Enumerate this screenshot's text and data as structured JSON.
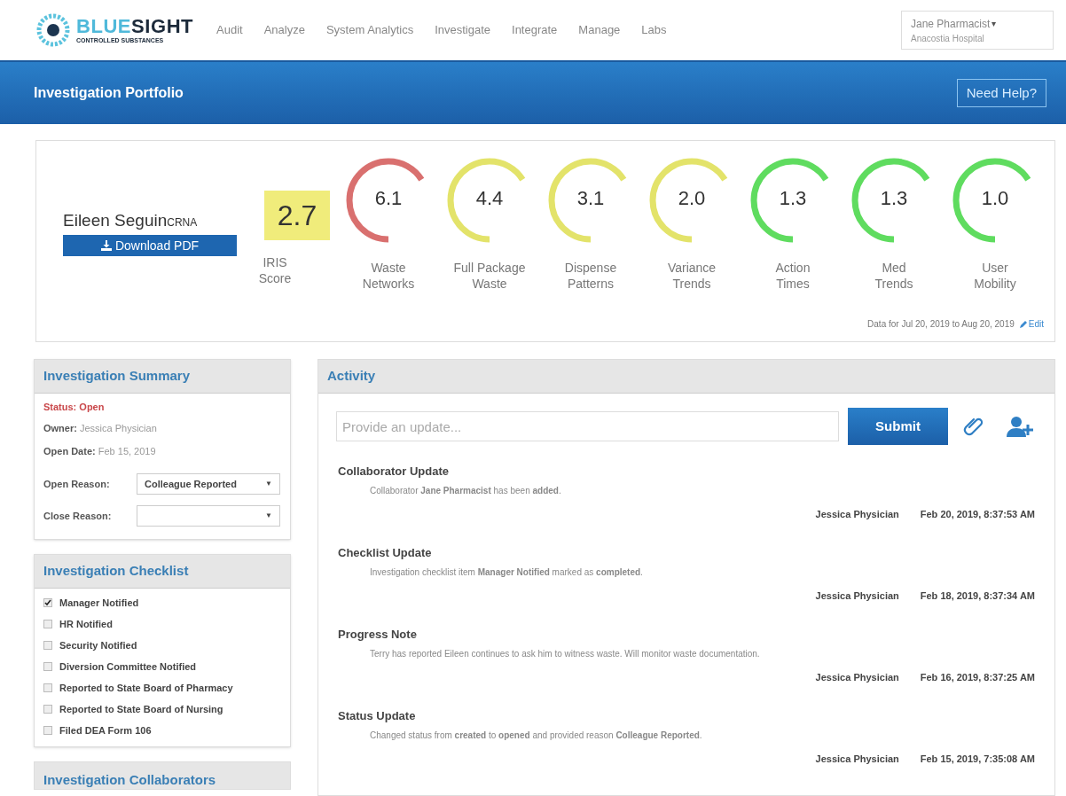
{
  "brand": {
    "name_part_1": "BLUE",
    "name_part_2": "SIGHT",
    "tagline": "CONTROLLED SUBSTANCES"
  },
  "nav": [
    "Audit",
    "Analyze",
    "System Analytics",
    "Investigate",
    "Integrate",
    "Manage",
    "Labs"
  ],
  "user": {
    "name": "Jane Pharmacist",
    "caret": "▾",
    "location": "Anacostia Hospital"
  },
  "page_title": "Investigation Portfolio",
  "help_button": "Need Help?",
  "subject": {
    "name": "Eileen Seguin",
    "credential": "CRNA",
    "download_button": "Download PDF"
  },
  "iris": {
    "score": "2.7",
    "label_line_1": "IRIS",
    "label_line_2": "Score"
  },
  "gauges": [
    {
      "value": "6.1",
      "label_line_1": "Waste",
      "label_line_2": "Networks",
      "color": "#d9706f"
    },
    {
      "value": "4.4",
      "label_line_1": "Full Package",
      "label_line_2": "Waste",
      "color": "#e3e36a"
    },
    {
      "value": "3.1",
      "label_line_1": "Dispense",
      "label_line_2": "Patterns",
      "color": "#e3e36a"
    },
    {
      "value": "2.0",
      "label_line_1": "Variance",
      "label_line_2": "Trends",
      "color": "#e3e36a"
    },
    {
      "value": "1.3",
      "label_line_1": "Action",
      "label_line_2": "Times",
      "color": "#5fdc5f"
    },
    {
      "value": "1.3",
      "label_line_1": "Med",
      "label_line_2": "Trends",
      "color": "#5fdc5f"
    },
    {
      "value": "1.0",
      "label_line_1": "User",
      "label_line_2": "Mobility",
      "color": "#5fdc5f"
    }
  ],
  "date_range": "Data for Jul 20, 2019 to Aug 20, 2019",
  "edit_link": "Edit",
  "summary": {
    "title": "Investigation Summary",
    "status": "Status: Open",
    "owner_label": "Owner:",
    "owner": "Jessica Physician",
    "open_date_label": "Open Date:",
    "open_date": "Feb 15, 2019",
    "open_reason_label": "Open Reason:",
    "open_reason": "Colleague Reported",
    "open_reason_caret": "▼",
    "close_reason_label": "Close Reason:",
    "close_reason_caret": "▼"
  },
  "checklist": {
    "title": "Investigation Checklist",
    "items": [
      {
        "label": "Manager Notified",
        "checked": true
      },
      {
        "label": "HR Notified",
        "checked": false
      },
      {
        "label": "Security Notified",
        "checked": false
      },
      {
        "label": "Diversion Committee Notified",
        "checked": false
      },
      {
        "label": "Reported to State Board of Pharmacy",
        "checked": false
      },
      {
        "label": "Reported to State Board of Nursing",
        "checked": false
      },
      {
        "label": "Filed DEA Form 106",
        "checked": false
      }
    ]
  },
  "collaborators": {
    "title": "Investigation Collaborators"
  },
  "activity": {
    "title": "Activity",
    "placeholder": "Provide an update...",
    "submit": "Submit",
    "entries": [
      {
        "title": "Collaborator Update",
        "body": "Collaborator **Jane Pharmacist** has been **added**.",
        "author": "Jessica Physician",
        "time": "Feb 20, 2019, 8:37:53 AM"
      },
      {
        "title": "Checklist Update",
        "body": "Investigation checklist item **Manager Notified** marked as **completed**.",
        "author": "Jessica Physician",
        "time": "Feb 18, 2019, 8:37:34 AM"
      },
      {
        "title": "Progress Note",
        "body": "Terry has reported Eileen continues to ask him to witness waste. Will monitor waste documentation.",
        "author": "Jessica Physician",
        "time": "Feb 16, 2019, 8:37:25 AM"
      },
      {
        "title": "Status Update",
        "body": "Changed status from **created** to **opened** and provided reason **Colleague Reported**.",
        "author": "Jessica Physician",
        "time": "Feb 15, 2019, 7:35:08 AM"
      }
    ]
  }
}
